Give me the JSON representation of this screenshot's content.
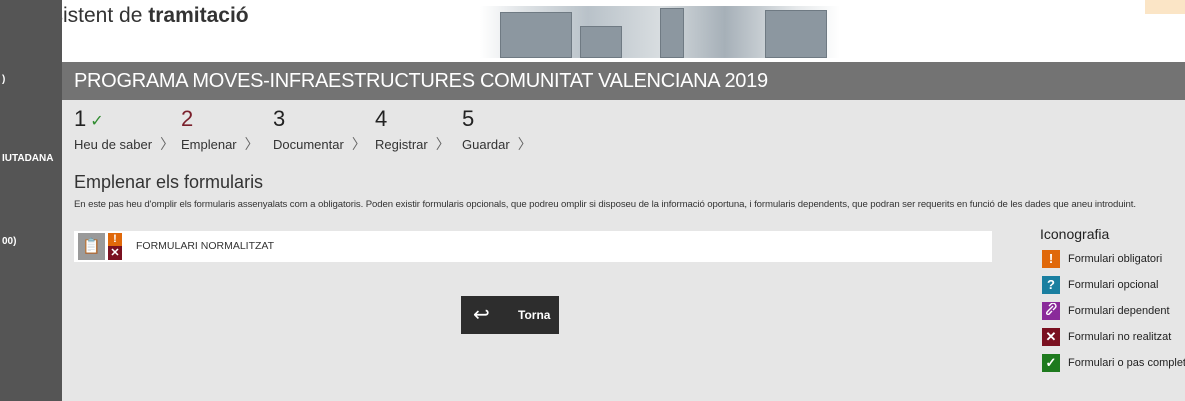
{
  "sidebar": {
    "items": [
      {
        "label": ")"
      },
      {
        "label": "IUTADANA"
      },
      {
        "label": "00)"
      }
    ]
  },
  "header": {
    "title_prefix": "Assistent de",
    "title_bold": "tramitació"
  },
  "program_title": "PROGRAMA MOVES-INFRAESTRUCTURES COMUNITAT VALENCIANA 2019",
  "steps": [
    {
      "number": "1",
      "label": "Heu de saber",
      "completed": true,
      "active": false
    },
    {
      "number": "2",
      "label": "Emplenar",
      "completed": false,
      "active": true
    },
    {
      "number": "3",
      "label": "Documentar",
      "completed": false,
      "active": false
    },
    {
      "number": "4",
      "label": "Registrar",
      "completed": false,
      "active": false
    },
    {
      "number": "5",
      "label": "Guardar",
      "completed": false,
      "active": false
    }
  ],
  "section": {
    "title": "Emplenar els formularis",
    "description": "En este pas heu d'omplir els formularis assenyalats com a obligatoris. Poden existir formularis opcionals, que podreu omplir si disposeu de la informació oportuna, i formularis dependents, que podran ser requerits en funció de les dades que aneu introduint."
  },
  "forms": [
    {
      "name": "FORMULARI NORMALITZAT",
      "icon": "clipboard-icon",
      "status_icons": [
        "mandatory-icon",
        "not-done-icon"
      ]
    }
  ],
  "back_button": {
    "label": "Torna",
    "icon": "return-arrow-icon"
  },
  "legend": {
    "title": "Iconografia",
    "items": [
      {
        "icon": "exclamation-icon",
        "glyph": "!",
        "color": "#e0680a",
        "label": "Formulari obligatori"
      },
      {
        "icon": "question-icon",
        "glyph": "?",
        "color": "#1a7fa0",
        "label": "Formulari opcional"
      },
      {
        "icon": "link-icon",
        "glyph": "🔗",
        "color": "#8a2a9a",
        "label": "Formulari dependent"
      },
      {
        "icon": "cross-icon",
        "glyph": "✕",
        "color": "#7a1020",
        "label": "Formulari no realitzat"
      },
      {
        "icon": "check-icon",
        "glyph": "✓",
        "color": "#1e7a1e",
        "label": "Formulari o pas completat"
      }
    ]
  },
  "colors": {
    "title_bar": "#737373",
    "active_step": "#7a1f2b",
    "content_bg": "#e6e6e6"
  }
}
